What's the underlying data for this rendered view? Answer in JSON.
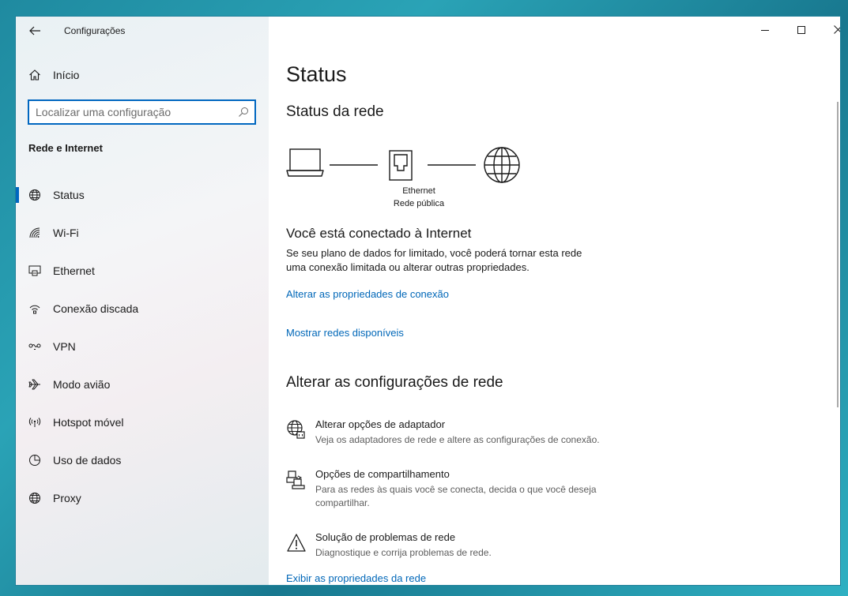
{
  "window": {
    "app_title": "Configurações"
  },
  "sidebar": {
    "home_label": "Início",
    "search_placeholder": "Localizar uma configuração",
    "section_title": "Rede e Internet",
    "items": [
      {
        "label": "Status",
        "icon": "globe-icon",
        "selected": true
      },
      {
        "label": "Wi-Fi",
        "icon": "wifi-icon"
      },
      {
        "label": "Ethernet",
        "icon": "ethernet-icon"
      },
      {
        "label": "Conexão discada",
        "icon": "dialup-icon"
      },
      {
        "label": "VPN",
        "icon": "vpn-icon"
      },
      {
        "label": "Modo avião",
        "icon": "airplane-icon"
      },
      {
        "label": "Hotspot móvel",
        "icon": "hotspot-icon"
      },
      {
        "label": "Uso de dados",
        "icon": "data-usage-icon"
      },
      {
        "label": "Proxy",
        "icon": "globe-icon"
      }
    ]
  },
  "main": {
    "title": "Status",
    "network_status": {
      "heading": "Status da rede",
      "adapter_name": "Ethernet",
      "network_type": "Rede pública"
    },
    "connection": {
      "heading": "Você está conectado à Internet",
      "description_line1": "Se seu plano de dados for limitado, você poderá tornar esta rede",
      "description_line2": "uma conexão limitada ou alterar outras propriedades.",
      "link_properties": "Alterar as propriedades de conexão",
      "link_networks": "Mostrar redes disponíveis"
    },
    "change_settings": {
      "heading": "Alterar as configurações de rede",
      "options": [
        {
          "title": "Alterar opções de adaptador",
          "desc": "Veja os adaptadores de rede e altere as configurações de conexão.",
          "icon": "adapter-icon"
        },
        {
          "title": "Opções de compartilhamento",
          "desc": "Para as redes às quais você se conecta, decida o que você deseja compartilhar.",
          "icon": "sharing-icon"
        },
        {
          "title": "Solução de problemas de rede",
          "desc": "Diagnostique e corrija problemas de rede.",
          "icon": "warning-icon"
        }
      ],
      "link_view_properties": "Exibir as propriedades da rede"
    }
  },
  "colors": {
    "accent": "#0067c0",
    "link": "#0067b8"
  }
}
